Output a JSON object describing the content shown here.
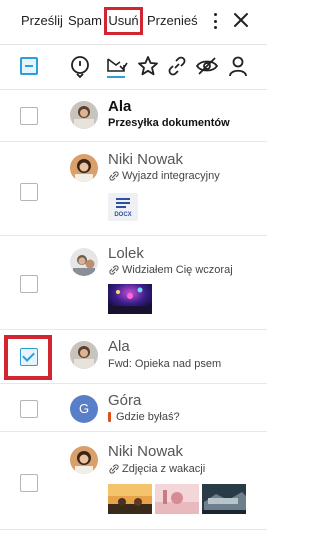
{
  "toolbar": {
    "forward": "Prześlij",
    "spam": "Spam",
    "delete": "Usuń",
    "move": "Przenieś",
    "more_icon": "more-vertical-icon",
    "close_icon": "close-icon"
  },
  "filters": {
    "icons": [
      "mention-icon",
      "unread-mail-icon",
      "star-icon",
      "attachment-link-icon",
      "hidden-eye-icon",
      "person-icon"
    ],
    "active": "unread-mail-icon"
  },
  "accent": "#2b9fd6",
  "highlight": "#d32431",
  "messages": [
    {
      "sender": "Ala",
      "subject": "Przesyłka dokumentów",
      "unread": true,
      "checked": false
    },
    {
      "sender": "Niki Nowak",
      "subject": "Wyjazd integracyjny",
      "attachment": true,
      "files": [
        "DOCX"
      ],
      "checked": false
    },
    {
      "sender": "Lolek",
      "subject": "Widziałem Cię wczoraj",
      "attachment": true,
      "checked": false
    },
    {
      "sender": "Ala",
      "subject": "Fwd: Opieka nad psem",
      "checked": true
    },
    {
      "sender": "Góra",
      "avatar_letter": "G",
      "subject": "Gdzie byłaś?",
      "important": true,
      "checked": false
    },
    {
      "sender": "Niki Nowak",
      "subject": "Zdjęcia z wakacji",
      "attachment": true,
      "checked": false
    }
  ]
}
